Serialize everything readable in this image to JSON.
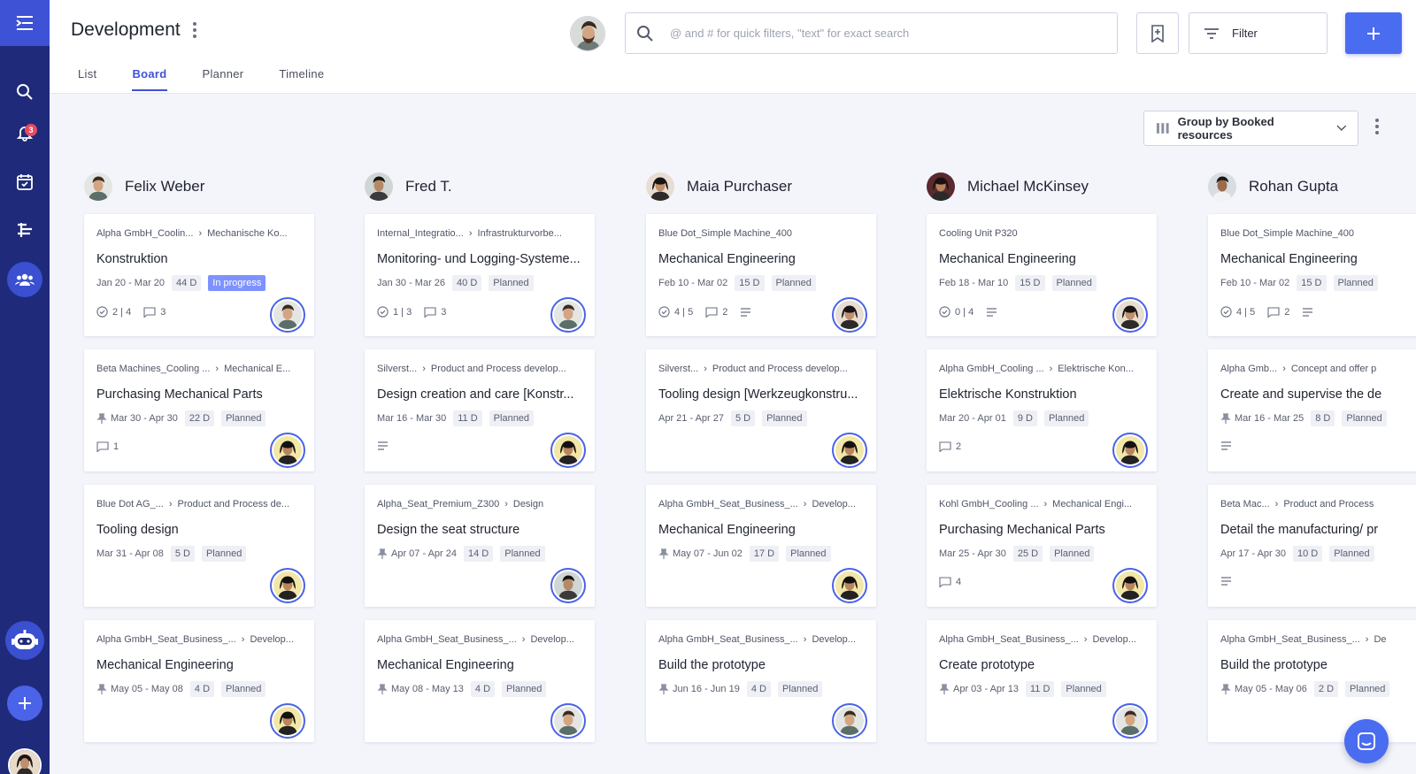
{
  "header": {
    "title": "Development",
    "tabs": [
      {
        "label": "List",
        "active": false
      },
      {
        "label": "Board",
        "active": true
      },
      {
        "label": "Planner",
        "active": false
      },
      {
        "label": "Timeline",
        "active": false
      }
    ],
    "search_placeholder": "@ and # for quick filters, \"text\" for exact search",
    "filter_label": "Filter"
  },
  "rail": {
    "notification_count": "3",
    "icons": [
      "menu-collapse-icon",
      "search-icon",
      "bell-icon",
      "calendar-check-icon",
      "gantt-icon",
      "team-icon",
      "bot-icon",
      "plus-icon"
    ]
  },
  "toolbar": {
    "group_by_label": "Group by Booked resources"
  },
  "colors": {
    "rail": "#1f2a7a",
    "rail_top": "#3e52d6",
    "accent": "#4a6cf0",
    "in_progress": "#7e92ff"
  },
  "columns": [
    {
      "name": "Felix Weber",
      "avatar": "m1",
      "cards": [
        {
          "crumb1": "Alpha GmbH_Coolin...",
          "crumb2": "Mechanische Ko...",
          "title": "Konstruktion",
          "dates": "Jan 20 - Mar 20",
          "days": "44 D",
          "status": "In progress",
          "pinned": false,
          "checks": "2 | 4",
          "comments": "3",
          "desc": false,
          "ava": "m1"
        },
        {
          "crumb1": "Beta Machines_Cooling ...",
          "crumb2": "Mechanical E...",
          "title": "Purchasing Mechanical Parts",
          "dates": "Mar 30 - Apr 30",
          "days": "22 D",
          "status": "Planned",
          "pinned": true,
          "checks": "",
          "comments": "1",
          "desc": false,
          "ava": "f2"
        },
        {
          "crumb1": "Blue Dot AG_...",
          "crumb2": "Product and Process de...",
          "title": "Tooling design",
          "dates": "Mar 31 - Apr 08",
          "days": "5 D",
          "status": "Planned",
          "pinned": false,
          "checks": "",
          "comments": "",
          "desc": false,
          "ava": "f2"
        },
        {
          "crumb1": "Alpha GmbH_Seat_Business_...",
          "crumb2": "Develop...",
          "title": "Mechanical Engineering",
          "dates": "May 05 - May 08",
          "days": "4 D",
          "status": "Planned",
          "pinned": true,
          "checks": "",
          "comments": "",
          "desc": false,
          "ava": "f2"
        }
      ]
    },
    {
      "name": "Fred T.",
      "avatar": "m2",
      "cards": [
        {
          "crumb1": "Internal_Integratio...",
          "crumb2": "Infrastrukturvorbe...",
          "title": "Monitoring- und Logging-Systeme...",
          "dates": "Jan 30 - Mar 26",
          "days": "40 D",
          "status": "Planned",
          "pinned": false,
          "checks": "1 | 3",
          "comments": "3",
          "desc": false,
          "ava": "m1"
        },
        {
          "crumb1": "Silverst...",
          "crumb2": "Product and Process develop...",
          "title": "Design creation and care [Konstr...",
          "dates": "Mar 16 - Mar 30",
          "days": "11 D",
          "status": "Planned",
          "pinned": false,
          "checks": "",
          "comments": "",
          "desc": true,
          "ava": "f2"
        },
        {
          "crumb1": "Alpha_Seat_Premium_Z300",
          "crumb2": "Design",
          "title": "Design the seat structure",
          "dates": "Apr 07 - Apr 24",
          "days": "14 D",
          "status": "Planned",
          "pinned": true,
          "checks": "",
          "comments": "",
          "desc": false,
          "ava": "m2"
        },
        {
          "crumb1": "Alpha GmbH_Seat_Business_...",
          "crumb2": "Develop...",
          "title": "Mechanical Engineering",
          "dates": "May 08 - May 13",
          "days": "4 D",
          "status": "Planned",
          "pinned": true,
          "checks": "",
          "comments": "",
          "desc": false,
          "ava": "m1"
        }
      ]
    },
    {
      "name": "Maia Purchaser",
      "avatar": "f1",
      "cards": [
        {
          "crumb1": "Blue Dot_Simple Machine_400",
          "crumb2": "",
          "title": "Mechanical Engineering",
          "dates": "Feb 10 - Mar 02",
          "days": "15 D",
          "status": "Planned",
          "pinned": false,
          "checks": "4 | 5",
          "comments": "2",
          "desc": true,
          "ava": "f1"
        },
        {
          "crumb1": "Silverst...",
          "crumb2": "Product and Process develop...",
          "title": "Tooling design [Werkzeugkonstru...",
          "dates": "Apr 21 - Apr 27",
          "days": "5 D",
          "status": "Planned",
          "pinned": false,
          "checks": "",
          "comments": "",
          "desc": false,
          "ava": "f2"
        },
        {
          "crumb1": "Alpha GmbH_Seat_Business_...",
          "crumb2": "Develop...",
          "title": "Mechanical Engineering",
          "dates": "May 07 - Jun 02",
          "days": "17 D",
          "status": "Planned",
          "pinned": true,
          "checks": "",
          "comments": "",
          "desc": false,
          "ava": "f2"
        },
        {
          "crumb1": "Alpha GmbH_Seat_Business_...",
          "crumb2": "Develop...",
          "title": "Build the prototype",
          "dates": "Jun 16 - Jun 19",
          "days": "4 D",
          "status": "Planned",
          "pinned": true,
          "checks": "",
          "comments": "",
          "desc": false,
          "ava": "m1"
        }
      ]
    },
    {
      "name": "Michael McKinsey",
      "avatar": "f3",
      "cards": [
        {
          "crumb1": "Cooling Unit P320",
          "crumb2": "",
          "title": "Mechanical Engineering",
          "dates": "Feb 18 - Mar 10",
          "days": "15 D",
          "status": "Planned",
          "pinned": false,
          "checks": "0 | 4",
          "comments": "",
          "desc": true,
          "ava": "f1"
        },
        {
          "crumb1": "Alpha GmbH_Cooling ...",
          "crumb2": "Elektrische Kon...",
          "title": "Elektrische Konstruktion",
          "dates": "Mar 20 - Apr 01",
          "days": "9 D",
          "status": "Planned",
          "pinned": false,
          "checks": "",
          "comments": "2",
          "desc": false,
          "ava": "f2"
        },
        {
          "crumb1": "Kohl GmbH_Cooling ...",
          "crumb2": "Mechanical Engi...",
          "title": "Purchasing Mechanical Parts",
          "dates": "Mar 25 - Apr 30",
          "days": "25 D",
          "status": "Planned",
          "pinned": false,
          "checks": "",
          "comments": "4",
          "desc": false,
          "ava": "f2"
        },
        {
          "crumb1": "Alpha GmbH_Seat_Business_...",
          "crumb2": "Develop...",
          "title": "Create prototype",
          "dates": "Apr 03 - Apr 13",
          "days": "11 D",
          "status": "Planned",
          "pinned": true,
          "checks": "",
          "comments": "",
          "desc": false,
          "ava": "m1"
        }
      ]
    },
    {
      "name": "Rohan Gupta",
      "avatar": "m3",
      "cards": [
        {
          "crumb1": "Blue Dot_Simple Machine_400",
          "crumb2": "",
          "title": "Mechanical Engineering",
          "dates": "Feb 10 - Mar 02",
          "days": "15 D",
          "status": "Planned",
          "pinned": false,
          "checks": "4 | 5",
          "comments": "2",
          "desc": true,
          "ava": ""
        },
        {
          "crumb1": "Alpha Gmb...",
          "crumb2": "Concept and offer p",
          "title": "Create and supervise the de",
          "dates": "Mar 16 - Mar 25",
          "days": "8 D",
          "status": "Planned",
          "pinned": true,
          "checks": "",
          "comments": "",
          "desc": true,
          "ava": ""
        },
        {
          "crumb1": "Beta Mac...",
          "crumb2": "Product and Process",
          "title": "Detail the manufacturing/ pr",
          "dates": "Apr 17 - Apr 30",
          "days": "10 D",
          "status": "Planned",
          "pinned": false,
          "checks": "",
          "comments": "",
          "desc": true,
          "ava": ""
        },
        {
          "crumb1": "Alpha GmbH_Seat_Business_...",
          "crumb2": "De",
          "title": "Build the prototype",
          "dates": "May 05 - May 06",
          "days": "2 D",
          "status": "Planned",
          "pinned": true,
          "checks": "",
          "comments": "",
          "desc": false,
          "ava": ""
        }
      ]
    }
  ]
}
